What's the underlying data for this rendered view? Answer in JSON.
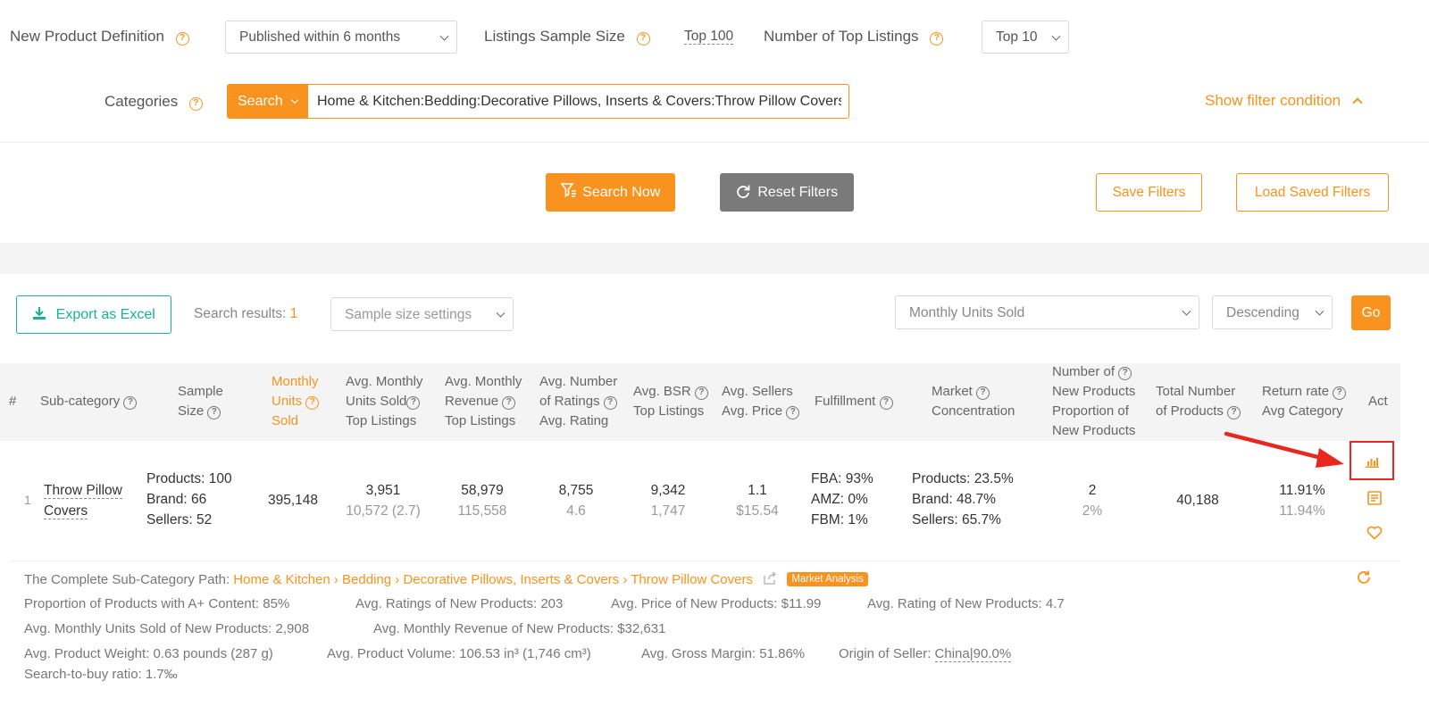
{
  "filters": {
    "new_product_label": "New Product Definition",
    "new_product_value": "Published within 6 months",
    "listings_sample_label": "Listings Sample Size",
    "listings_sample_value": "Top 100",
    "top_listings_label": "Number of Top Listings",
    "top_listings_value": "Top 10",
    "categories_label": "Categories",
    "search_dropdown": "Search",
    "category_path": "Home & Kitchen:Bedding:Decorative Pillows, Inserts & Covers:Throw Pillow Covers",
    "show_filter": "Show filter condition"
  },
  "actions": {
    "search_now": "Search Now",
    "reset_filters": "Reset Filters",
    "save_filters": "Save Filters",
    "load_saved": "Load Saved Filters"
  },
  "results_bar": {
    "export": "Export as Excel",
    "search_results_label": "Search results:",
    "search_results_count": "1",
    "sample_size_placeholder": "Sample size settings",
    "sort_field": "Monthly Units Sold",
    "sort_order": "Descending",
    "go": "Go"
  },
  "table": {
    "headers": {
      "num": "#",
      "subcategory": "Sub-category",
      "sample_1": "Sample",
      "sample_2": "Size",
      "monthly_1": "Monthly",
      "monthly_2": "Units",
      "monthly_3": "Sold",
      "avg_units_1": "Avg. Monthly",
      "avg_units_2": "Units Sold",
      "avg_units_3": "Top Listings",
      "avg_rev_1": "Avg. Monthly",
      "avg_rev_2": "Revenue",
      "avg_rev_3": "Top Listings",
      "ratings_1": "Avg. Number",
      "ratings_2": "of Ratings",
      "ratings_3": "Avg. Rating",
      "bsr_1": "Avg. BSR",
      "bsr_2": "Top Listings",
      "sellers_1": "Avg. Sellers",
      "sellers_2": "Avg. Price",
      "fulfillment": "Fulfillment",
      "market_1": "Market",
      "market_2": "Concentration",
      "newprod_1": "Number of",
      "newprod_2": "New Products",
      "newprod_3": "Proportion of",
      "newprod_4": "New Products",
      "total_1": "Total Number",
      "total_2": "of Products",
      "return_1": "Return rate",
      "return_2": "Avg Category",
      "act": "Act"
    },
    "row": {
      "num": "1",
      "subcategory_1": "Throw Pillow",
      "subcategory_2": "Covers",
      "products": "Products: 100",
      "brand": "Brand: 66",
      "sellers": "Sellers: 52",
      "monthly_units": "395,148",
      "avg_units": "3,951",
      "avg_units_sub": "10,572 (2.7)",
      "avg_revenue": "58,979",
      "avg_revenue_sub": "115,558",
      "ratings": "8,755",
      "rating_avg": "4.6",
      "bsr": "9,342",
      "bsr_sub": "1,747",
      "avg_sellers": "1.1",
      "avg_price": "$15.54",
      "fba": "FBA: 93%",
      "amz": "AMZ: 0%",
      "fbm": "FBM: 1%",
      "mc_products": "Products: 23.5%",
      "mc_brand": "Brand: 48.7%",
      "mc_sellers": "Sellers: 65.7%",
      "new_products": "2",
      "new_products_pct": "2%",
      "total_products": "40,188",
      "return_rate": "11.91%",
      "return_avg": "11.94%"
    }
  },
  "details": {
    "path_label": "The Complete Sub-Category Path:",
    "path_1": "Home & Kitchen",
    "path_2": "Bedding",
    "path_3": "Decorative Pillows, Inserts & Covers",
    "path_4": "Throw Pillow Covers",
    "sep": "›",
    "market_badge": "Market Analysis",
    "aplus": "Proportion of Products with A+ Content: 85%",
    "avg_ratings_new": "Avg. Ratings of New Products: 203",
    "avg_price_new": "Avg. Price of New Products: $11.99",
    "avg_rating_new": "Avg. Rating of New Products: 4.7",
    "avg_units_new": "Avg. Monthly Units Sold of New Products: 2,908",
    "avg_rev_new": "Avg. Monthly Revenue of New Products: $32,631",
    "weight": "Avg. Product Weight: 0.63 pounds (287 g)",
    "volume": "Avg. Product Volume: 106.53 in³ (1,746 cm³)",
    "margin": "Avg. Gross Margin: 51.86%",
    "origin_label": "Origin of Seller:",
    "origin_value": "China|90.0%",
    "search_buy": "Search-to-buy ratio: 1.7‰"
  },
  "colors": {
    "accent": "#f7931e",
    "teal": "#19b394",
    "gray_btn": "#7a7a7a",
    "highlight": "#e8281e"
  }
}
